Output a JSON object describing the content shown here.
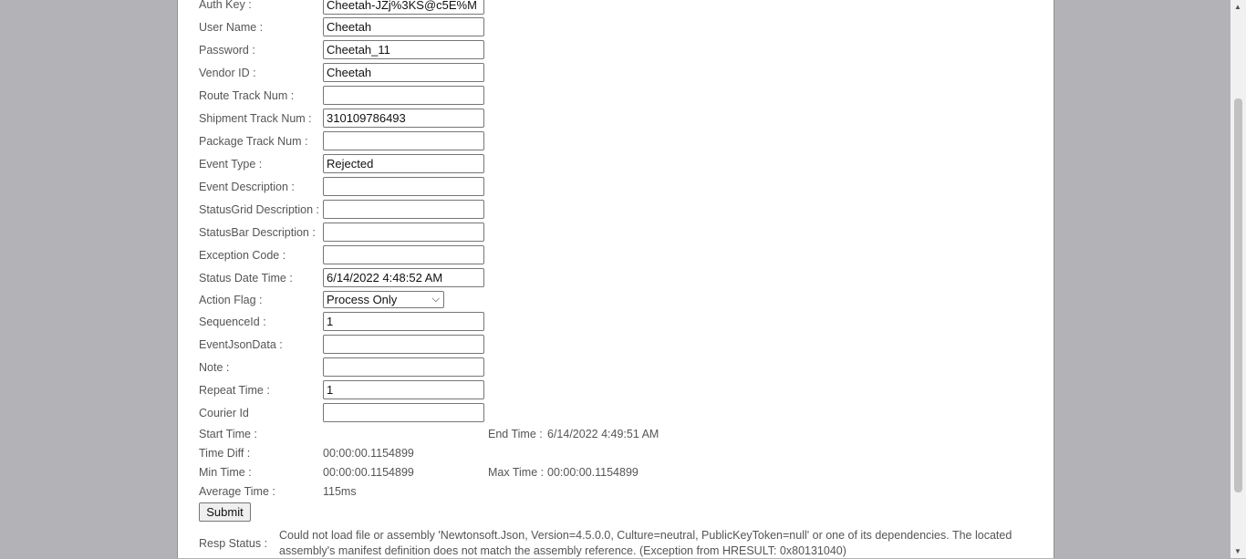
{
  "form": {
    "fields": [
      {
        "label": "Auth Key :",
        "value": "Cheetah-JZj%3KS@c5E%M"
      },
      {
        "label": "User Name :",
        "value": "Cheetah"
      },
      {
        "label": "Password :",
        "value": "Cheetah_11"
      },
      {
        "label": "Vendor ID :",
        "value": "Cheetah"
      },
      {
        "label": "Route Track Num :",
        "value": ""
      },
      {
        "label": "Shipment Track Num :",
        "value": "310109786493"
      },
      {
        "label": "Package Track Num :",
        "value": ""
      },
      {
        "label": "Event Type :",
        "value": "Rejected"
      },
      {
        "label": "Event Description :",
        "value": ""
      },
      {
        "label": "StatusGrid Description :",
        "value": ""
      },
      {
        "label": "StatusBar Description :",
        "value": ""
      },
      {
        "label": "Exception Code :",
        "value": ""
      },
      {
        "label": "Status Date Time :",
        "value": "6/14/2022 4:48:52 AM"
      }
    ],
    "action_flag": {
      "label": "Action Flag :",
      "selected": "Process Only"
    },
    "fields2": [
      {
        "label": "SequenceId :",
        "value": "1"
      },
      {
        "label": "EventJsonData :",
        "value": ""
      },
      {
        "label": "Note :",
        "value": ""
      },
      {
        "label": "Repeat Time :",
        "value": "1"
      },
      {
        "label": "Courier Id",
        "value": ""
      }
    ]
  },
  "timing": {
    "start_time_label": "Start Time :",
    "start_time_value": "",
    "end_time_label": "End Time :",
    "end_time_value": "6/14/2022 4:49:51 AM",
    "time_diff_label": "Time Diff :",
    "time_diff_value": "00:00:00.1154899",
    "min_time_label": "Min Time :",
    "min_time_value": "00:00:00.1154899",
    "max_time_label": "Max Time :",
    "max_time_value": "00:00:00.1154899",
    "avg_time_label": "Average Time :",
    "avg_time_value": "115ms"
  },
  "submit_label": "Submit",
  "response": {
    "label": "Resp Status :",
    "text": "Could not load file or assembly 'Newtonsoft.Json, Version=4.5.0.0, Culture=neutral, PublicKeyToken=null' or one of its dependencies. The located assembly's manifest definition does not match the assembly reference. (Exception from HRESULT: 0x80131040)"
  }
}
